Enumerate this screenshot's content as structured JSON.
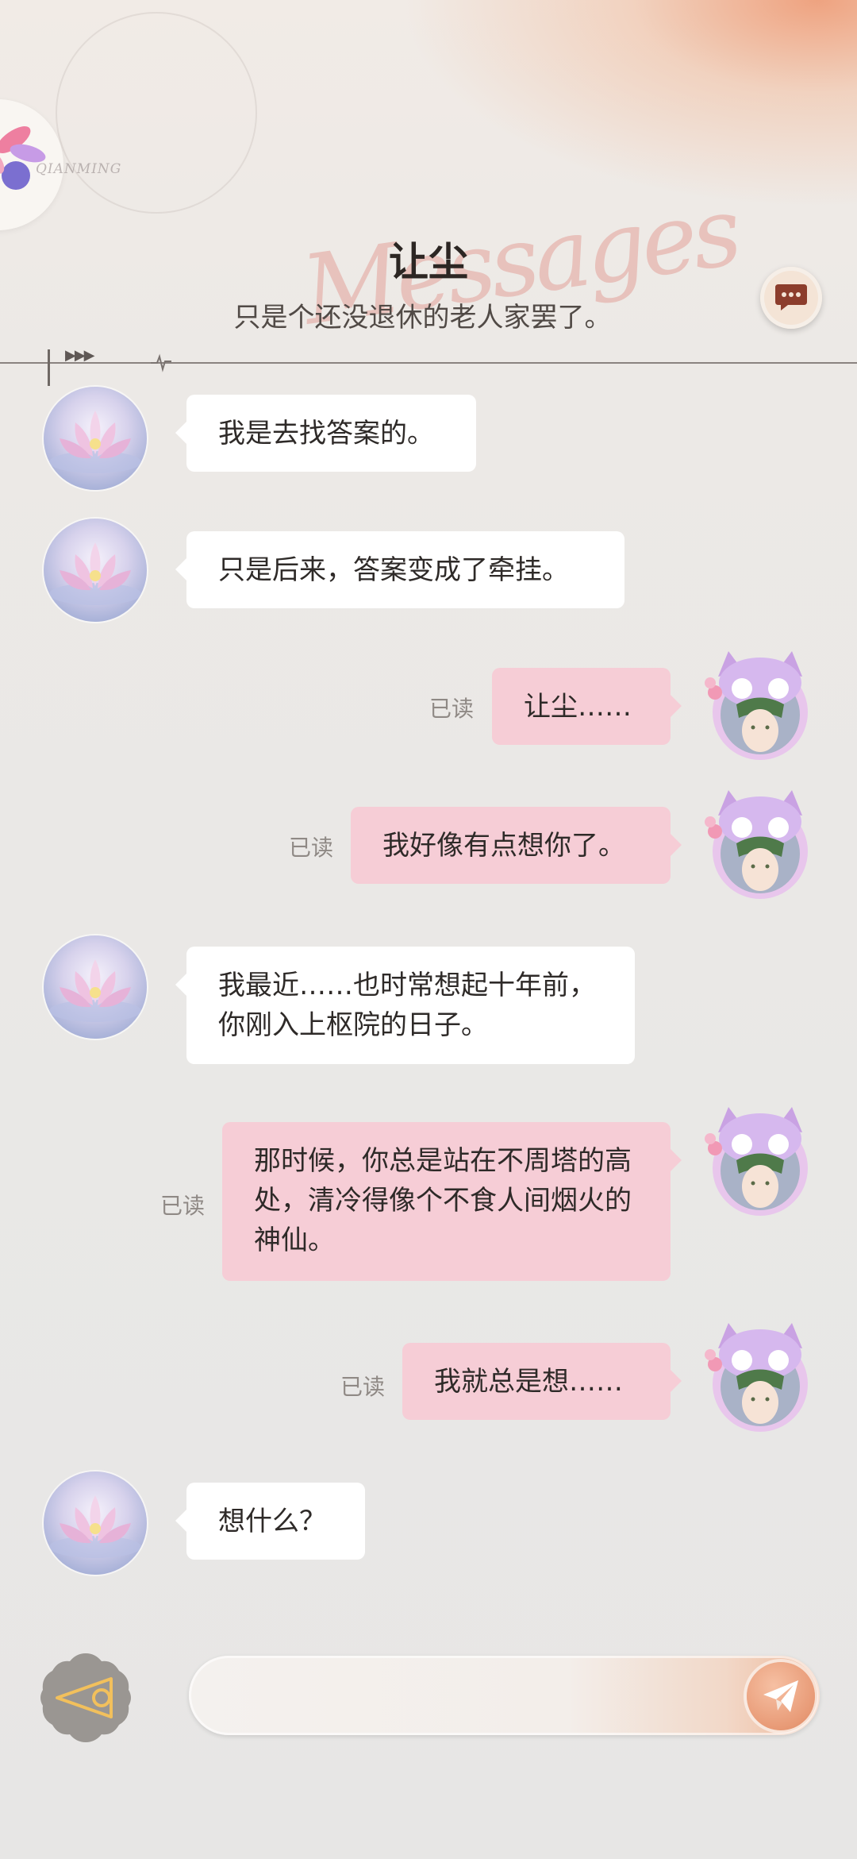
{
  "header": {
    "contact_name": "让尘",
    "status": "只是个还没退休的老人家罢了。",
    "script_watermark": "Messages",
    "logo_text": "QIANMING"
  },
  "messages": [
    {
      "side": "left",
      "text": "我是去找答案的。"
    },
    {
      "side": "left",
      "text": "只是后来，答案变成了牵挂。"
    },
    {
      "side": "right",
      "text": "让尘……",
      "read": "已读"
    },
    {
      "side": "right",
      "text": "我好像有点想你了。",
      "read": "已读"
    },
    {
      "side": "left",
      "text": "我最近……也时常想起十年前，你刚入上枢院的日子。"
    },
    {
      "side": "right",
      "text": "那时候，你总是站在不周塔的高处，清冷得像个不食人间烟火的神仙。",
      "read": "已读"
    },
    {
      "side": "right",
      "text": "我就总是想……",
      "read": "已读"
    },
    {
      "side": "left",
      "text": "想什么？"
    }
  ],
  "input": {
    "placeholder": "",
    "value": ""
  },
  "icons": {
    "chat": "chat-bubble-icon",
    "back": "triangle-back-icon",
    "send": "paper-plane-icon"
  },
  "colors": {
    "left_bubble": "#ffffff",
    "right_bubble": "#f6cdd6",
    "accent": "#e89a76"
  }
}
